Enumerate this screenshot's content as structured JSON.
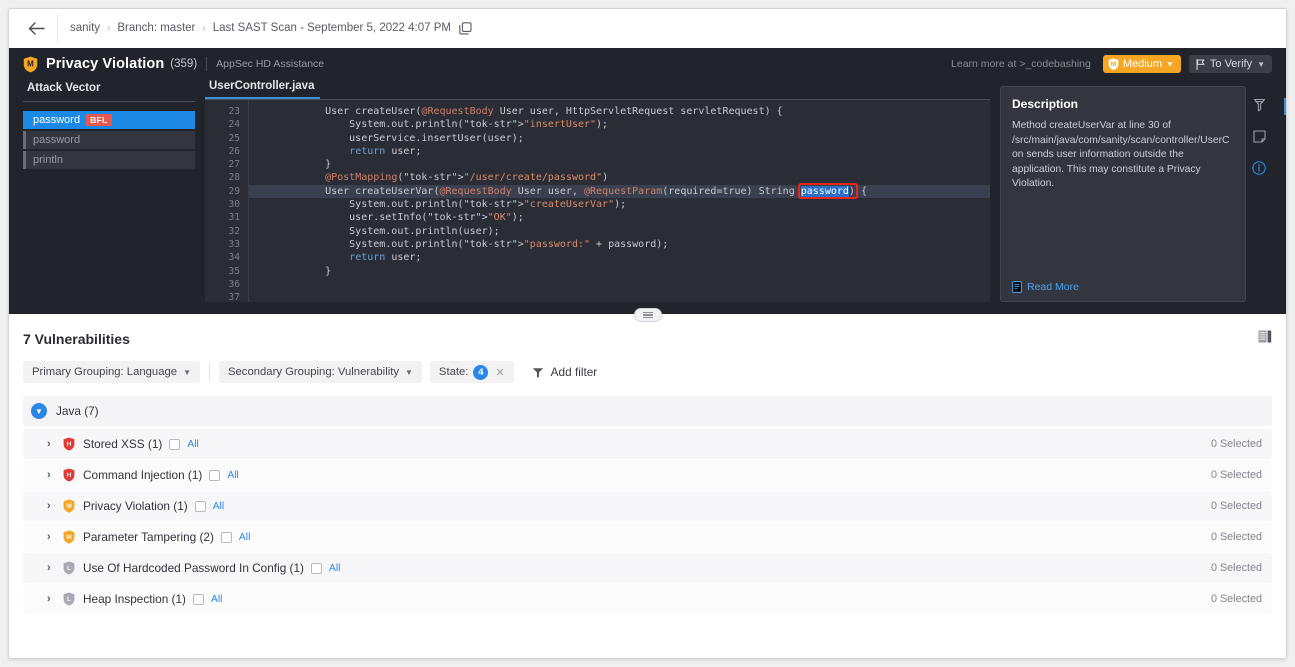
{
  "breadcrumb": {
    "back_icon": "back-arrow-icon",
    "items": [
      {
        "label": "sanity"
      },
      {
        "label": "Branch: master"
      },
      {
        "label": "Last SAST Scan - September 5, 2022 4:07 PM"
      }
    ],
    "separator": "›",
    "copy_icon": "copy-icon"
  },
  "detail": {
    "title": "Privacy Violation",
    "count": "(359)",
    "subtitle": "AppSec HD Assistance",
    "codebashing_text": "Learn more at >_codebashing",
    "severity": {
      "label": "Medium",
      "color": "#f5a623",
      "icon": "shield-medium-icon"
    },
    "state": {
      "label": "To Verify",
      "icon": "flag-icon",
      "color": "#3b3d47"
    },
    "attack_vector": {
      "title": "Attack Vector",
      "items": [
        {
          "label": "password",
          "tag": "BFL",
          "selected": true
        },
        {
          "label": "password",
          "tag": "",
          "selected": false
        },
        {
          "label": "println",
          "tag": "",
          "selected": false
        }
      ]
    },
    "code": {
      "tab": "UserController.java",
      "line_numbers": [
        "23",
        "24",
        "25",
        "26",
        "27",
        "28",
        "29",
        "30",
        "31",
        "32",
        "33",
        "34",
        "35",
        "36",
        "37"
      ],
      "lines": [
        "    User createUser(@RequestBody User user, HttpServletRequest servletRequest) {",
        "        System.out.println(\"insertUser\");",
        "        userService.insertUser(user);",
        "        return user;",
        "    }",
        "",
        "    @PostMapping(\"/user/create/password\")",
        "    User createUserVar(@RequestBody User user, @RequestParam(required=true) String password) {",
        "        System.out.println(\"createUserVar\");",
        "        user.setInfo(\"OK\");",
        "        System.out.println(user);",
        "        System.out.println(\"password:\" + password);",
        "        return user;",
        "    }",
        ""
      ],
      "highlighted_line_index": 7,
      "highlighted_token": "password"
    },
    "description": {
      "title": "Description",
      "text": "Method createUserVar at line 30 of /src/main/java/com/sanity/scan/controller/UserCon sends user information outside the application. This may constitute a Privacy Violation.",
      "read_more": "Read More",
      "rail_icons": [
        "filter-funnel-icon",
        "note-icon",
        "info-icon"
      ]
    }
  },
  "vulnerabilities": {
    "title": "7 Vulnerabilities",
    "list_view_icon": "list-view-icon",
    "filters": {
      "primary_grouping": "Primary Grouping: Language",
      "secondary_grouping": "Secondary Grouping: Vulnerability",
      "state_label": "State:",
      "state_count": "4",
      "add_filter": "Add filter",
      "add_filter_icon": "filter-icon"
    },
    "group": {
      "label": "Java (7)",
      "expanded": true
    },
    "rows": [
      {
        "label": "Stored XSS (1)",
        "severity": "high",
        "severity_letter": "H",
        "all_label": "All",
        "selected_text": "0 Selected"
      },
      {
        "label": "Command Injection (1)",
        "severity": "high",
        "severity_letter": "H",
        "all_label": "All",
        "selected_text": "0 Selected"
      },
      {
        "label": "Privacy Violation (1)",
        "severity": "medium",
        "severity_letter": "M",
        "all_label": "All",
        "selected_text": "0 Selected"
      },
      {
        "label": "Parameter Tampering (2)",
        "severity": "medium",
        "severity_letter": "M",
        "all_label": "All",
        "selected_text": "0 Selected"
      },
      {
        "label": "Use Of Hardcoded Password In Config (1)",
        "severity": "low",
        "severity_letter": "L",
        "all_label": "All",
        "selected_text": "0 Selected"
      },
      {
        "label": "Heap Inspection (1)",
        "severity": "low",
        "severity_letter": "L",
        "all_label": "All",
        "selected_text": "0 Selected"
      }
    ]
  },
  "colors": {
    "panel_bg": "#22242c",
    "code_bg": "#2b2d36",
    "accent_blue": "#2a86e8",
    "severity_high": "#e03b36",
    "severity_medium": "#f5a623",
    "severity_low": "#a9a9b4",
    "selection_blue": "#1e88e5",
    "highlight_box": "#e8261c"
  }
}
